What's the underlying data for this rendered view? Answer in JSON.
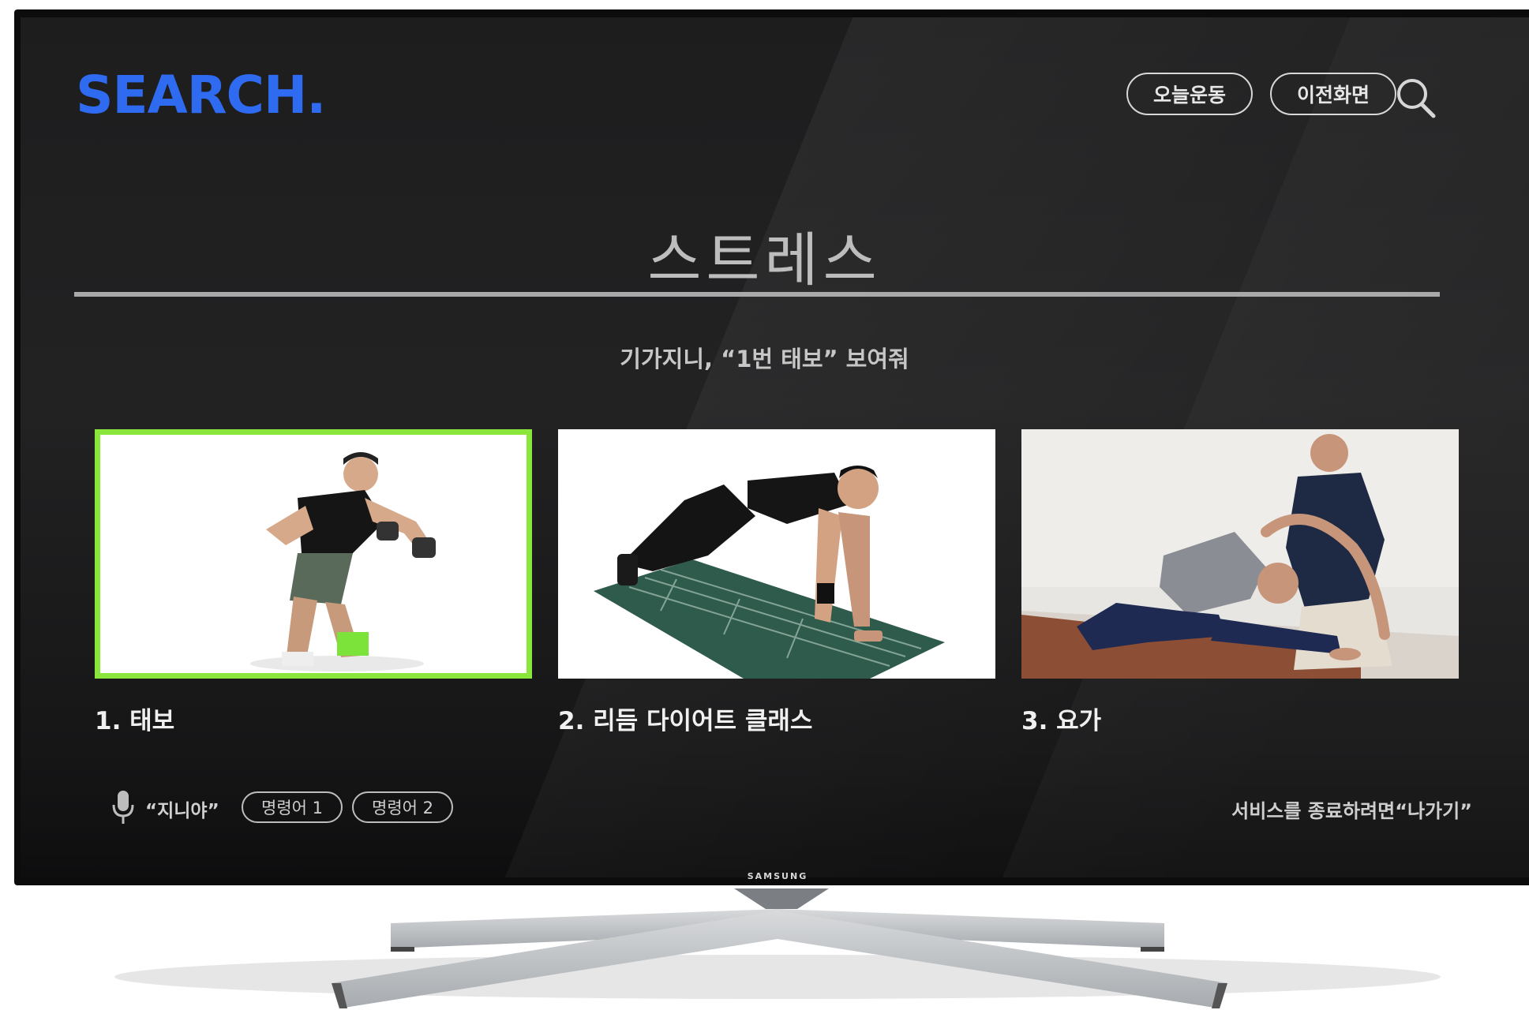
{
  "app": {
    "logo": "SEARCH.",
    "accent_color": "#2f6bf0",
    "selected_color": "#8be63c"
  },
  "header": {
    "today_workout_label": "오늘운동",
    "previous_screen_label": "이전화면",
    "search_icon": "search-icon"
  },
  "main": {
    "title": "스트레스",
    "voice_hint": "기가지니, “1번 태보” 보여줘",
    "cards": [
      {
        "label": "1. 태보",
        "selected": true,
        "thumbnail": "taebo-workout-photo"
      },
      {
        "label": "2. 리듬 다이어트 클래스",
        "selected": false,
        "thumbnail": "plank-mat-photo"
      },
      {
        "label": "3. 요가",
        "selected": false,
        "thumbnail": "yoga-stretch-photo"
      }
    ]
  },
  "footer": {
    "mic_icon": "microphone-icon",
    "wake_word": "“지니야”",
    "command1": "명령어 1",
    "command2": "명령어 2",
    "exit_hint": "서비스를 종료하려면“나가기”"
  },
  "device": {
    "brand": "SAMSUNG"
  }
}
